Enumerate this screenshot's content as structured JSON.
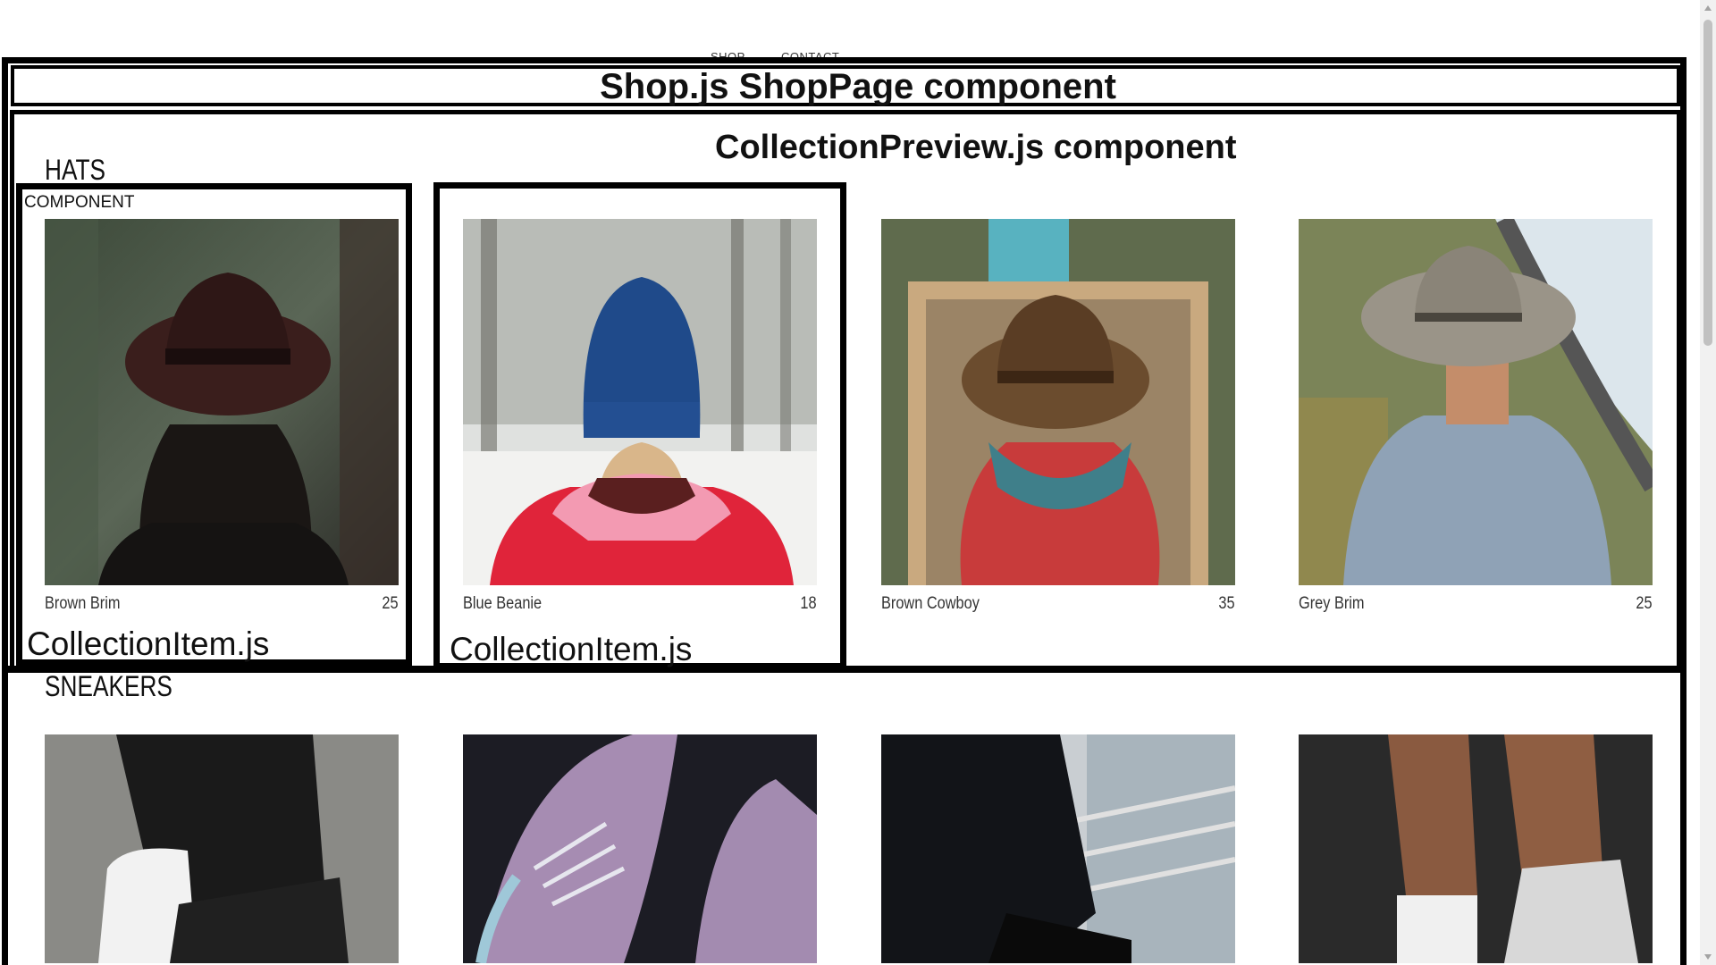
{
  "nav": {
    "shop": "SHOP",
    "contact": "CONTACT"
  },
  "annotations": {
    "shop_page": "Shop.js ShopPage component",
    "collection_preview": "CollectionPreview.js component",
    "component": "COMPONENT",
    "collection_item_1": "CollectionItem.js",
    "collection_item_2": "CollectionItem.js"
  },
  "collections": [
    {
      "title": "HATS",
      "items": [
        {
          "name": "Brown Brim",
          "price": "25"
        },
        {
          "name": "Blue Beanie",
          "price": "18"
        },
        {
          "name": "Brown Cowboy",
          "price": "35"
        },
        {
          "name": "Grey Brim",
          "price": "25"
        }
      ]
    },
    {
      "title": "SNEAKERS",
      "items": []
    }
  ]
}
